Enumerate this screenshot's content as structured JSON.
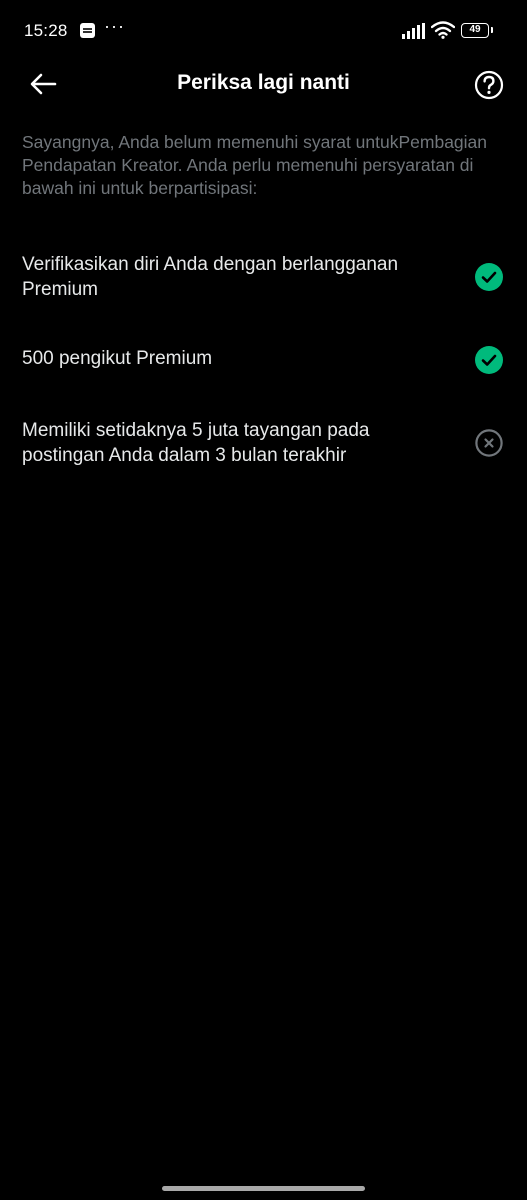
{
  "status_bar": {
    "time": "15:28",
    "more": "···",
    "battery_level": "49"
  },
  "header": {
    "title": "Periksa lagi nanti"
  },
  "intro": {
    "text": "Sayangnya, Anda belum memenuhi syarat untukPembagian Pendapatan Kreator. Anda perlu memenuhi persyaratan di bawah ini untuk berpartisipasi:"
  },
  "requirements": [
    {
      "label": "Verifikasikan diri Anda dengan berlangganan Premium",
      "met": true
    },
    {
      "label": "500 pengikut Premium",
      "met": true
    },
    {
      "label": "Memiliki setidaknya 5 juta tayangan pada postingan Anda dalam 3 bulan terakhir",
      "met": false
    }
  ],
  "colors": {
    "background": "#000000",
    "met": "#00ba7c",
    "unmet": "#71767b",
    "secondary_text": "#71767b"
  }
}
